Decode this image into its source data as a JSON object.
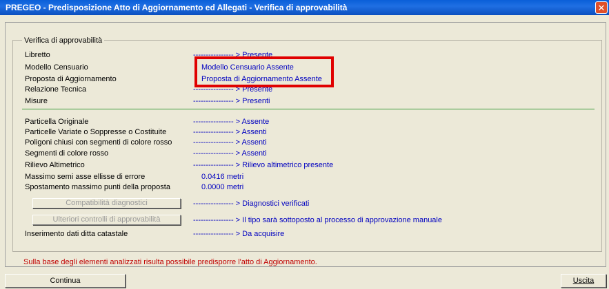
{
  "window": {
    "title": "PREGEO - Predisposizione Atto di Aggiornamento ed Allegati - Verifica di approvabilità",
    "close_glyph": "✕"
  },
  "group": {
    "title": "Verifica di approvabilità"
  },
  "rows_top": [
    {
      "label": "Libretto",
      "value": "---------------- > Presente"
    },
    {
      "label": "Modello Censuario",
      "value": "Modello Censuario Assente"
    },
    {
      "label": "Proposta di Aggiornamento",
      "value": "Proposta di Aggiornamento Assente"
    },
    {
      "label": "Relazione Tecnica",
      "value": "---------------- > Presente"
    },
    {
      "label": "Misure",
      "value": "---------------- > Presenti"
    }
  ],
  "rows_bottom": [
    {
      "label": "Particella Originale",
      "value": "---------------- > Assente"
    },
    {
      "label": "Particelle Variate o Soppresse o Costituite",
      "value": "---------------- > Assenti"
    },
    {
      "label": "Poligoni chiusi con segmenti di colore rosso",
      "value": "---------------- > Assenti"
    },
    {
      "label": "Segmenti di colore rosso",
      "value": "---------------- > Assenti"
    },
    {
      "label": "Rilievo Altimetrico",
      "value": "---------------- > Rilievo altimetrico presente"
    },
    {
      "label": "Massimo semi asse ellisse di errore",
      "value": "0.0416  metri"
    },
    {
      "label": "Spostamento massimo punti della proposta",
      "value": "0.0000 metri"
    }
  ],
  "buttons": {
    "compat_label": "Compatibilità diagnostici",
    "compat_value": "---------------- > Diagnostici verificati",
    "controls_label": "Ulteriori controlli di approvabilità",
    "controls_value": "---------------- > Il tipo sarà sottoposto al processo di approvazione manuale"
  },
  "inserimento": {
    "label": "Inserimento dati ditta catastale",
    "value": "---------------- > Da acquisire"
  },
  "message": "Sulla base degli elementi analizzati risulta possibile predisporre l'atto di Aggiornamento.",
  "footer": {
    "continue_label": "Continua",
    "exit_label": "Uscita"
  },
  "colors": {
    "value_text": "#0000c0",
    "highlight": "#e00000",
    "message_text": "#c00000",
    "separator": "#3a9a3a",
    "titlebar": "#0a5fd8"
  }
}
